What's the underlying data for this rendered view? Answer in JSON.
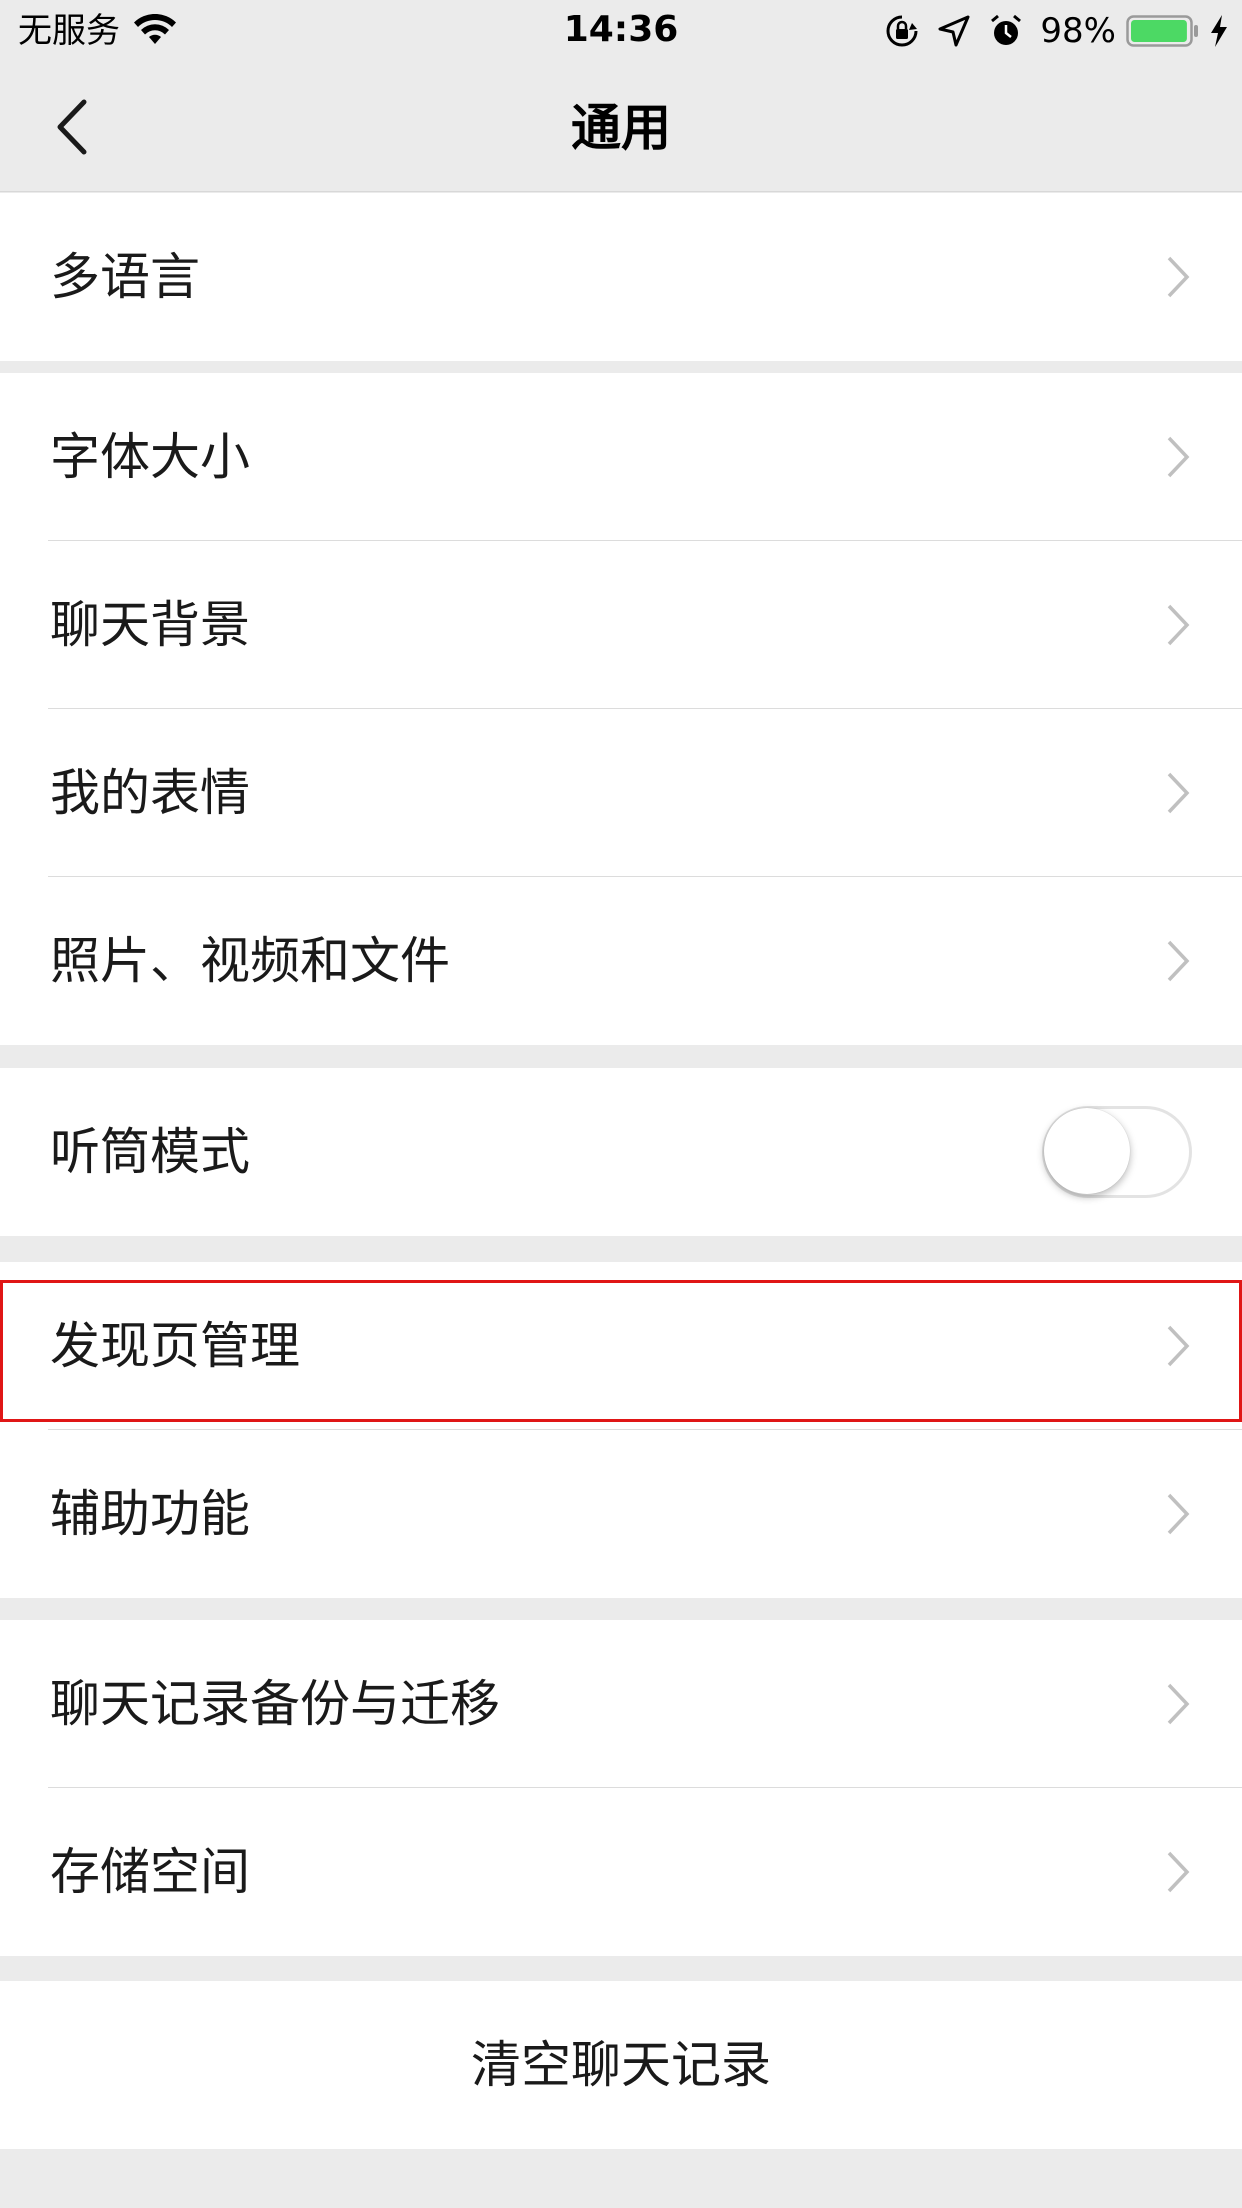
{
  "status_bar": {
    "carrier": "无服务",
    "time": "14:36",
    "battery_percent": "98%",
    "battery_level": 0.98,
    "battery_color": "#4cd964",
    "icons": [
      "wifi-icon",
      "orientation-lock-icon",
      "location-arrow-icon",
      "alarm-icon",
      "battery-icon",
      "charging-bolt-icon"
    ]
  },
  "nav": {
    "title": "通用",
    "back_icon": "chevron-left-icon"
  },
  "settings": {
    "language": {
      "label": "多语言"
    },
    "font_size": {
      "label": "字体大小"
    },
    "chat_background": {
      "label": "聊天背景"
    },
    "my_stickers": {
      "label": "我的表情"
    },
    "media_files": {
      "label": "照片、视频和文件"
    },
    "earpiece_mode": {
      "label": "听筒模式",
      "enabled": false
    },
    "discover_manage": {
      "label": "发现页管理",
      "highlighted": true,
      "highlight_color": "#e01616"
    },
    "accessibility": {
      "label": "辅助功能"
    },
    "chat_backup": {
      "label": "聊天记录备份与迁移"
    },
    "storage": {
      "label": "存储空间"
    },
    "clear_history": {
      "label": "清空聊天记录"
    }
  },
  "colors": {
    "background": "#ebebeb",
    "cell": "#ffffff",
    "separator": "#dcdcdc",
    "chevron": "#c0c0c0"
  }
}
